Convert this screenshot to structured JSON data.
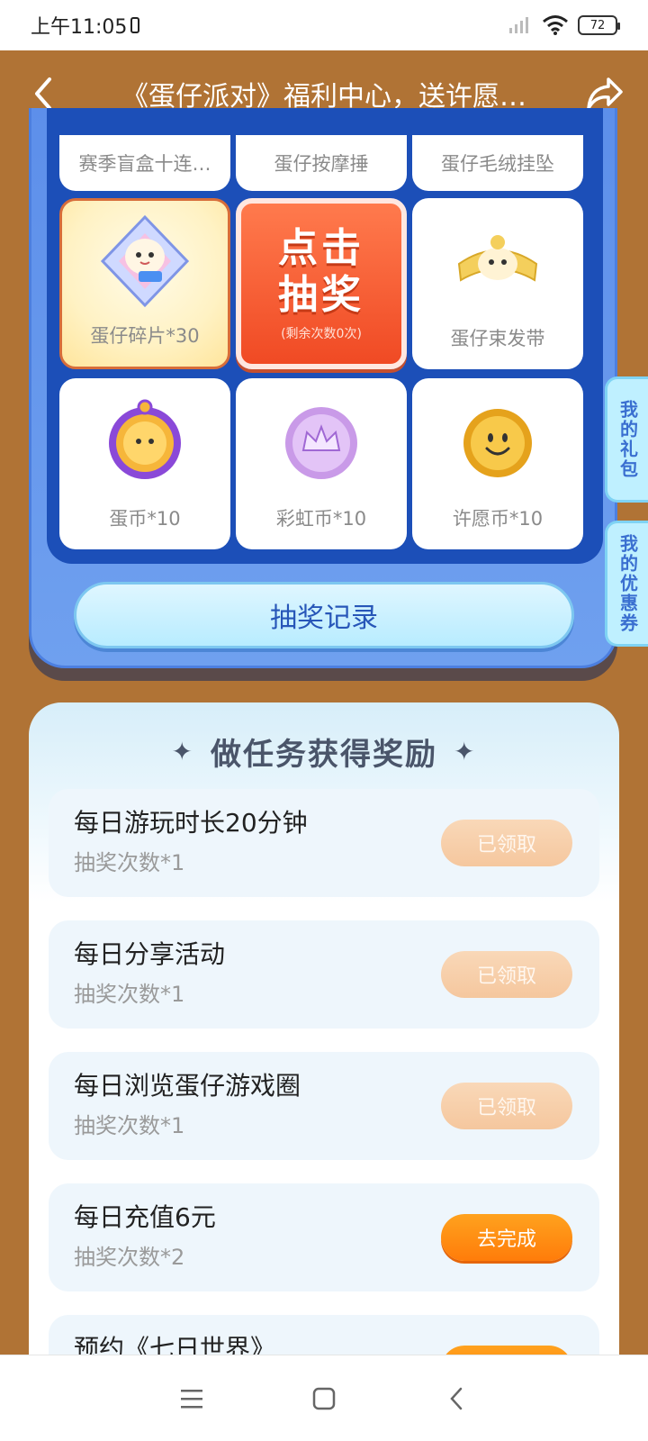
{
  "status_bar": {
    "time": "上午11:05",
    "battery": "72"
  },
  "header": {
    "title": "《蛋仔派对》福利中心，送许愿…"
  },
  "lottery": {
    "top_row": [
      "赛季盲盒十连…",
      "蛋仔按摩捶",
      "蛋仔毛绒挂坠"
    ],
    "row2": {
      "left": "蛋仔碎片*30",
      "center_title_line1": "点击",
      "center_title_line2": "抽奖",
      "center_sub": "(剩余次数0次)",
      "right": "蛋仔束发带"
    },
    "row3": [
      "蛋币*10",
      "彩虹币*10",
      "许愿币*10"
    ],
    "record_button": "抽奖记录"
  },
  "side_tabs": {
    "gift": "我的礼包",
    "coupon": "我的优惠券"
  },
  "tasks": {
    "title": "做任务获得奖励",
    "items": [
      {
        "name": "每日游玩时长20分钟",
        "reward": "抽奖次数*1",
        "button": "已领取",
        "status": "done"
      },
      {
        "name": "每日分享活动",
        "reward": "抽奖次数*1",
        "button": "已领取",
        "status": "done"
      },
      {
        "name": "每日浏览蛋仔游戏圈",
        "reward": "抽奖次数*1",
        "button": "已领取",
        "status": "done"
      },
      {
        "name": "每日充值6元",
        "reward": "抽奖次数*2",
        "button": "去完成",
        "status": "todo"
      },
      {
        "name": "预约《七日世界》",
        "reward": "",
        "button": "",
        "status": "todo"
      }
    ]
  },
  "colors": {
    "page_bg": "#b07335",
    "panel_blue": "#5d8fea",
    "grid_blue": "#1c4fb8",
    "draw_red": "#f04a24",
    "action_orange": "#ff7c0a"
  }
}
